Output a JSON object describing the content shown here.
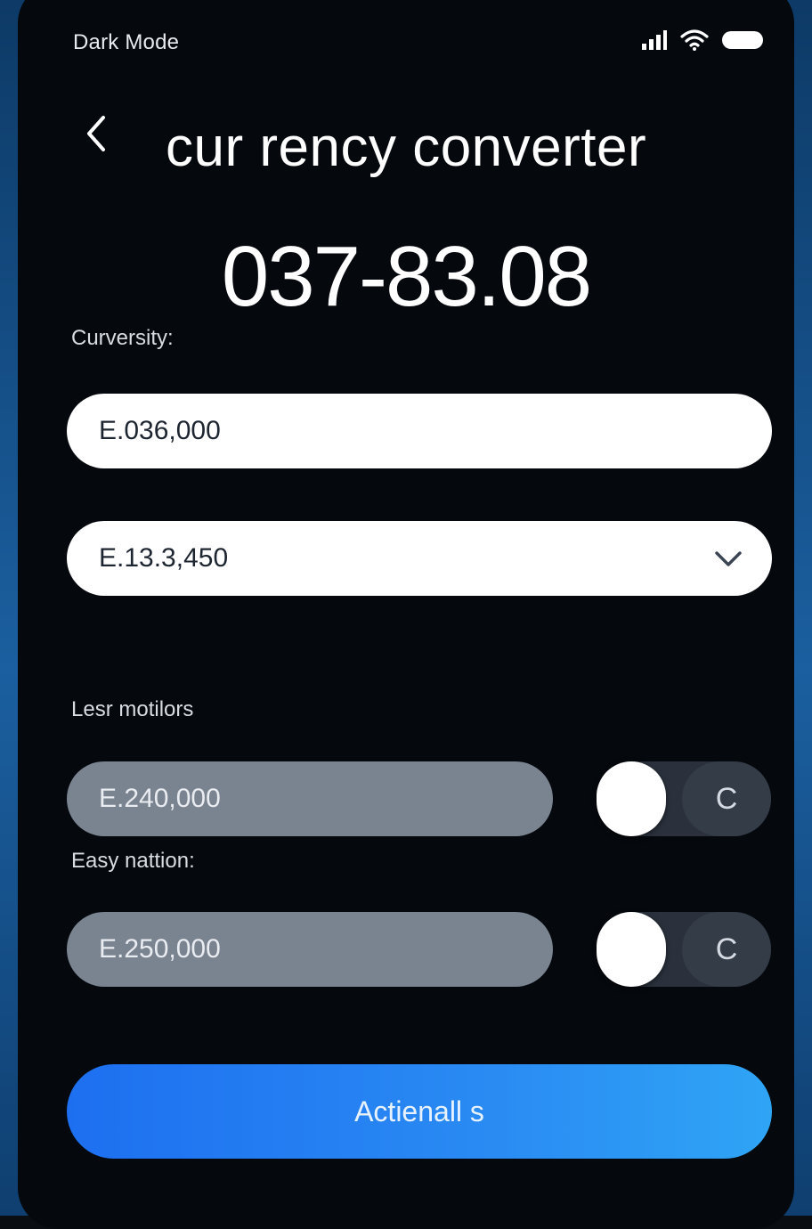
{
  "status_bar": {
    "label": "Dark Mode"
  },
  "header": {
    "title": "cur rency converter"
  },
  "display": {
    "value": "037-83.08"
  },
  "form": {
    "section_label": "Curversity:",
    "input_value": "E.036,000",
    "select_value": "E.13.3,450"
  },
  "rows": [
    {
      "label": "Lesr motilors",
      "value": "E.240,000",
      "toggle_label": "C"
    },
    {
      "label": "Easy nattion:",
      "value": "E.250,000",
      "toggle_label": "C"
    }
  ],
  "action_button": {
    "label": "Actienall s"
  },
  "colors": {
    "accent": "#2a8bf3",
    "background": "#05080d"
  }
}
